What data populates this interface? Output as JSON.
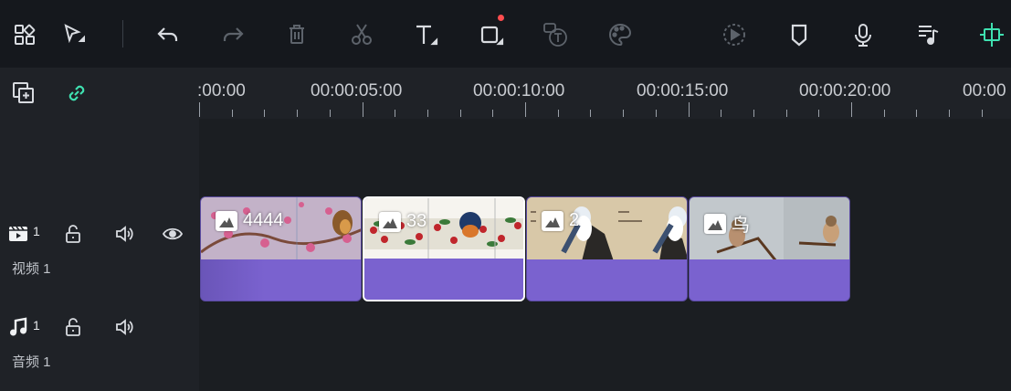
{
  "toolbar": {
    "tools": [
      {
        "name": "layout-grid-icon"
      },
      {
        "name": "select-arrow-icon"
      },
      {
        "name": "undo-icon"
      },
      {
        "name": "redo-icon"
      },
      {
        "name": "delete-icon"
      },
      {
        "name": "scissors-icon"
      },
      {
        "name": "text-icon"
      },
      {
        "name": "crop-icon"
      },
      {
        "name": "speech-to-text-icon"
      },
      {
        "name": "palette-icon"
      },
      {
        "name": "render-preview-icon"
      },
      {
        "name": "marker-icon"
      },
      {
        "name": "microphone-icon"
      },
      {
        "name": "music-list-icon"
      },
      {
        "name": "split-snap-icon"
      }
    ],
    "accent": "#3fe0b0"
  },
  "ruler": {
    "labels": [
      ":00:00",
      "00:00:05:00",
      "00:00:10:00",
      "00:00:15:00",
      "00:00:20:00",
      "00:00"
    ]
  },
  "tracks": {
    "video": {
      "number": "1",
      "name": "视频 1"
    },
    "audio": {
      "number": "1",
      "name": "音频 1"
    }
  },
  "clips": [
    {
      "label": "4444",
      "selected": false,
      "color": "#7a62cf"
    },
    {
      "label": "33",
      "selected": true,
      "color": "#7a62cf"
    },
    {
      "label": "2",
      "selected": false,
      "color": "#7a62cf"
    },
    {
      "label": "鸟",
      "selected": false,
      "color": "#7a62cf"
    }
  ]
}
